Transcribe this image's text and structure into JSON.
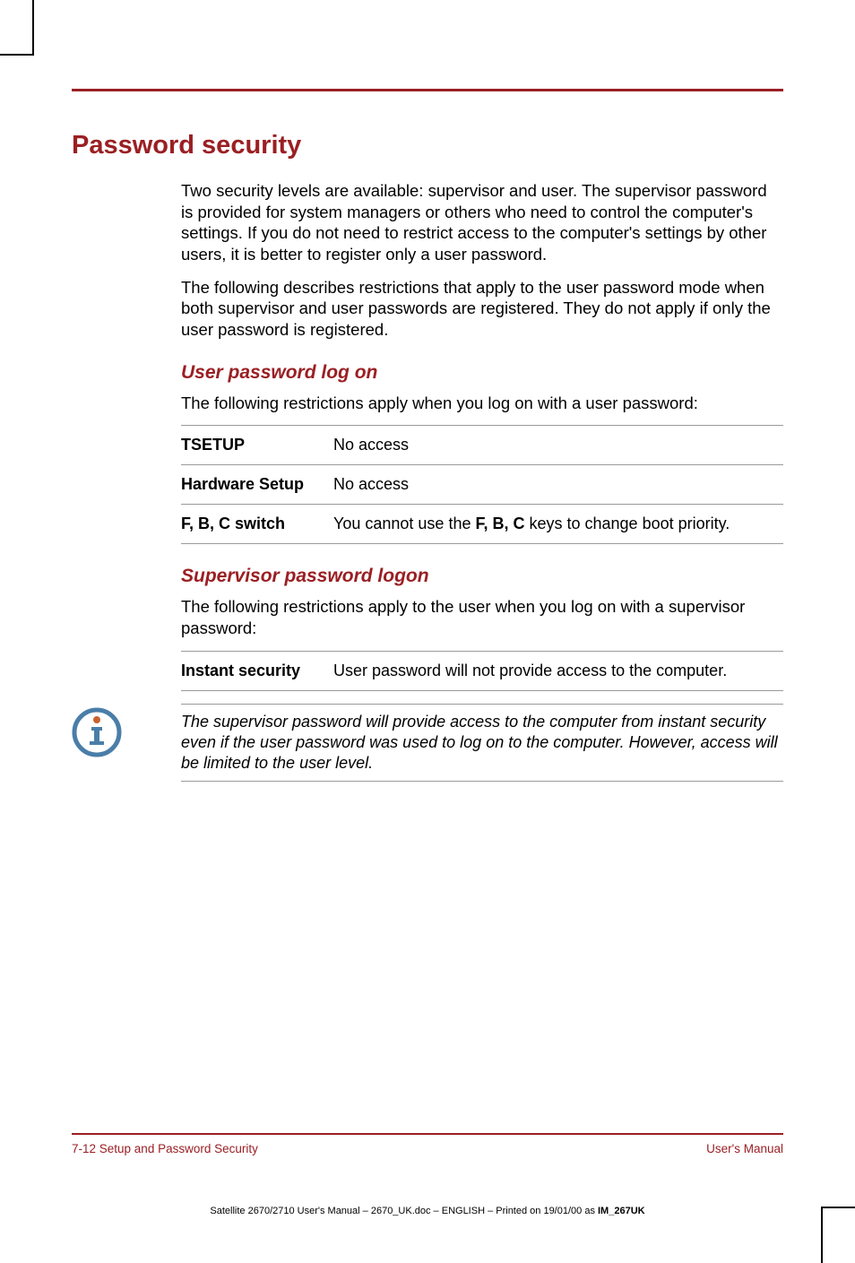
{
  "section_title": "Password security",
  "intro_p1": "Two security levels are available: supervisor and user. The supervisor password is provided for system managers or others who need to control the computer's settings. If you do not need to restrict access to the computer's settings by other users, it is better to register only a user password.",
  "intro_p2": "The following describes restrictions that apply to the user password mode when both supervisor and user passwords are registered. They do not apply if only the user password is registered.",
  "sub1": {
    "title": "User password log on",
    "lead": "The following restrictions apply when you log on with a user password:",
    "rows": [
      {
        "term": "TSETUP",
        "desc_pre": "No access",
        "desc_bold": "",
        "desc_post": ""
      },
      {
        "term": "Hardware Setup",
        "desc_pre": "No access",
        "desc_bold": "",
        "desc_post": ""
      },
      {
        "term": "F, B, C switch",
        "desc_pre": "You cannot use the ",
        "desc_bold": "F, B, C",
        "desc_post": " keys to change boot priority."
      }
    ]
  },
  "sub2": {
    "title": "Supervisor password logon",
    "lead": "The following restrictions apply to the user when you log on with a supervisor password:",
    "rows": [
      {
        "term": "Instant security",
        "desc_pre": "User password will not provide access to the computer.",
        "desc_bold": "",
        "desc_post": ""
      }
    ]
  },
  "note": "The supervisor password will provide access to the computer from instant security even if the user password was used to log on to the computer. However, access will be limited to the user level.",
  "footer": {
    "left": "7-12  Setup and Password Security",
    "right": "User's Manual"
  },
  "imprint": {
    "pre": "Satellite 2670/2710 User's Manual  – 2670_UK.doc – ENGLISH – Printed on 19/01/00 as ",
    "bold": "IM_267UK"
  }
}
